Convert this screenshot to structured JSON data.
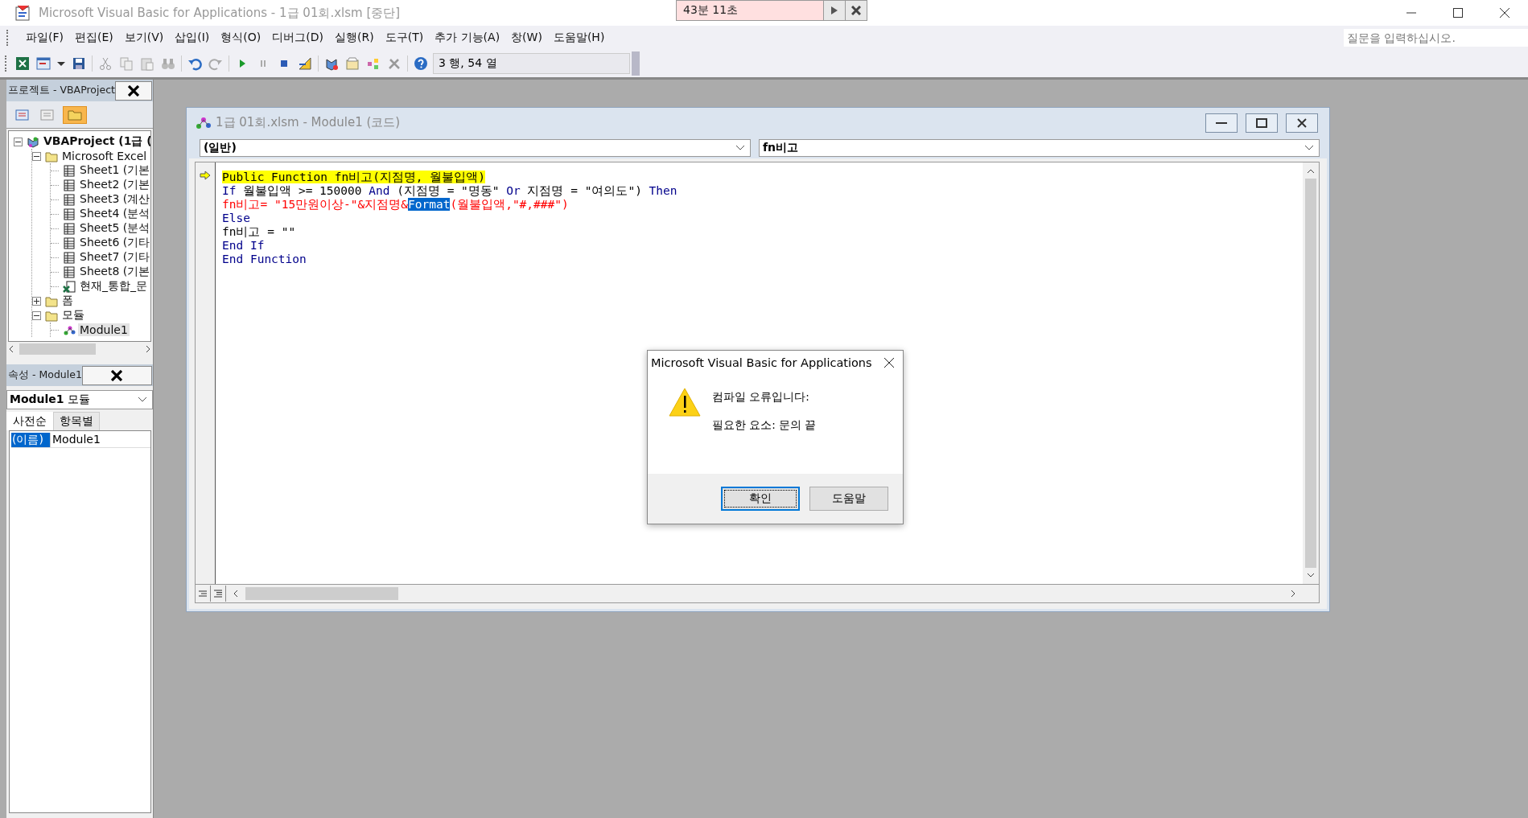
{
  "window": {
    "title": "Microsoft Visual Basic for Applications - 1급 01회.xlsm [중단]"
  },
  "timer": {
    "text": "43분 11초"
  },
  "menu": [
    {
      "label": "파일(F)"
    },
    {
      "label": "편집(E)"
    },
    {
      "label": "보기(V)"
    },
    {
      "label": "삽입(I)"
    },
    {
      "label": "형식(O)"
    },
    {
      "label": "디버그(D)"
    },
    {
      "label": "실행(R)"
    },
    {
      "label": "도구(T)"
    },
    {
      "label": "추가 기능(A)"
    },
    {
      "label": "창(W)"
    },
    {
      "label": "도움말(H)"
    }
  ],
  "help_search": {
    "placeholder": "질문을 입력하십시오."
  },
  "toolbar": {
    "position": "3 행, 54 열"
  },
  "project": {
    "title": "프로젝트 - VBAProject",
    "tree": [
      {
        "label": "VBAProject (1급 (",
        "kind": "project",
        "expanded": true,
        "selected": false,
        "children": [
          {
            "label": "Microsoft Excel",
            "kind": "folder",
            "expanded": true,
            "selected": false,
            "children": [
              {
                "label": "Sheet1 (기본",
                "kind": "sheet",
                "selected": false
              },
              {
                "label": "Sheet2 (기본",
                "kind": "sheet",
                "selected": false
              },
              {
                "label": "Sheet3 (계산",
                "kind": "sheet",
                "selected": false
              },
              {
                "label": "Sheet4 (분석",
                "kind": "sheet",
                "selected": false
              },
              {
                "label": "Sheet5 (분석",
                "kind": "sheet",
                "selected": false
              },
              {
                "label": "Sheet6 (기타",
                "kind": "sheet",
                "selected": false
              },
              {
                "label": "Sheet7 (기타",
                "kind": "sheet",
                "selected": false
              },
              {
                "label": "Sheet8 (기본",
                "kind": "sheet",
                "selected": false
              },
              {
                "label": "현재_통합_문",
                "kind": "workbook",
                "selected": false
              }
            ]
          },
          {
            "label": "폼",
            "kind": "folder",
            "expanded": false,
            "selected": false
          },
          {
            "label": "모듈",
            "kind": "folder",
            "expanded": true,
            "selected": false,
            "children": [
              {
                "label": "Module1",
                "kind": "module",
                "selected": true
              }
            ]
          }
        ]
      }
    ]
  },
  "properties": {
    "title": "속성 - Module1",
    "object": "**Module1** 모듈",
    "tabs": [
      {
        "label": "사전순",
        "selected": true
      },
      {
        "label": "항목별",
        "selected": false
      }
    ],
    "rows": [
      {
        "name": "(이름)",
        "value": "Module1",
        "selected": true
      }
    ]
  },
  "code_window": {
    "title": "1급 01회.xlsm - Module1 (코드)",
    "object": "(일반)",
    "procedure": "fn비고",
    "lines": [
      {
        "kind": "current",
        "tokens": [
          {
            "text": "Public Function fn비고(지점명, 월불입액)",
            "kind": "text"
          }
        ]
      },
      {
        "kind": "normal",
        "tokens": [
          {
            "text": "If",
            "kind": "keyword"
          },
          {
            "text": " 월불입액 >= 150000 ",
            "kind": "text"
          },
          {
            "text": "And",
            "kind": "keyword"
          },
          {
            "text": " (지점명 = \"명동\" ",
            "kind": "text"
          },
          {
            "text": "Or",
            "kind": "keyword"
          },
          {
            "text": " 지점명 = \"여의도\") ",
            "kind": "text"
          },
          {
            "text": "Then",
            "kind": "keyword"
          }
        ]
      },
      {
        "kind": "error",
        "tokens": [
          {
            "text": "fn비고= \"15만원이상-\"&지점명&",
            "kind": "text"
          },
          {
            "text": "Format",
            "kind": "selection"
          },
          {
            "text": "(월불입액,\"#,###\")",
            "kind": "text"
          }
        ]
      },
      {
        "kind": "normal",
        "tokens": [
          {
            "text": "Else",
            "kind": "keyword"
          }
        ]
      },
      {
        "kind": "normal",
        "tokens": [
          {
            "text": "fn비고 = \"\"",
            "kind": "text"
          }
        ]
      },
      {
        "kind": "normal",
        "tokens": [
          {
            "text": "End If",
            "kind": "keyword"
          }
        ]
      },
      {
        "kind": "normal",
        "tokens": [
          {
            "text": "End Function",
            "kind": "keyword"
          }
        ]
      }
    ]
  },
  "dialog": {
    "title": "Microsoft Visual Basic for Applications",
    "message": "컴파일 오류입니다:",
    "detail": "필요한 요소: 문의 끝",
    "buttons": [
      {
        "label": "확인",
        "focused": true
      },
      {
        "label": "도움말",
        "focused": false
      }
    ]
  }
}
